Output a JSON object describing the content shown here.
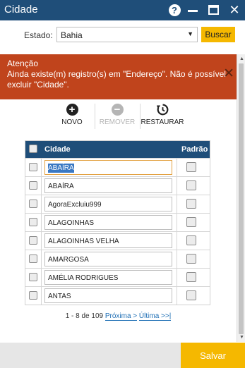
{
  "window": {
    "title": "Cidade"
  },
  "filter": {
    "label": "Estado:",
    "selected": "Bahia",
    "search_button": "Buscar"
  },
  "alert": {
    "title": "Atenção",
    "message": "Ainda existe(m) registro(s) em \"Endereço\". Não é possível excluir \"Cidade\"."
  },
  "toolbar": {
    "new_label": "NOVO",
    "remove_label": "REMOVER",
    "restore_label": "RESTAURAR"
  },
  "table": {
    "headers": {
      "city": "Cidade",
      "default": "Padrão"
    },
    "rows": [
      "ABAÍRA",
      "ABAÍRA",
      "AgoraExcluiu999",
      "ALAGOINHAS",
      "ALAGOINHAS VELHA",
      "AMARGOSA",
      "AMÉLIA RODRIGUES",
      "ANTAS"
    ]
  },
  "pager": {
    "range": "1 - 8 de 109",
    "next": "Próxima >",
    "last": "Última >>|"
  },
  "footer": {
    "save_label": "Salvar"
  },
  "colors": {
    "titlebar": "#1f4e79",
    "alert": "#c0441c",
    "accent": "#f5b800"
  }
}
